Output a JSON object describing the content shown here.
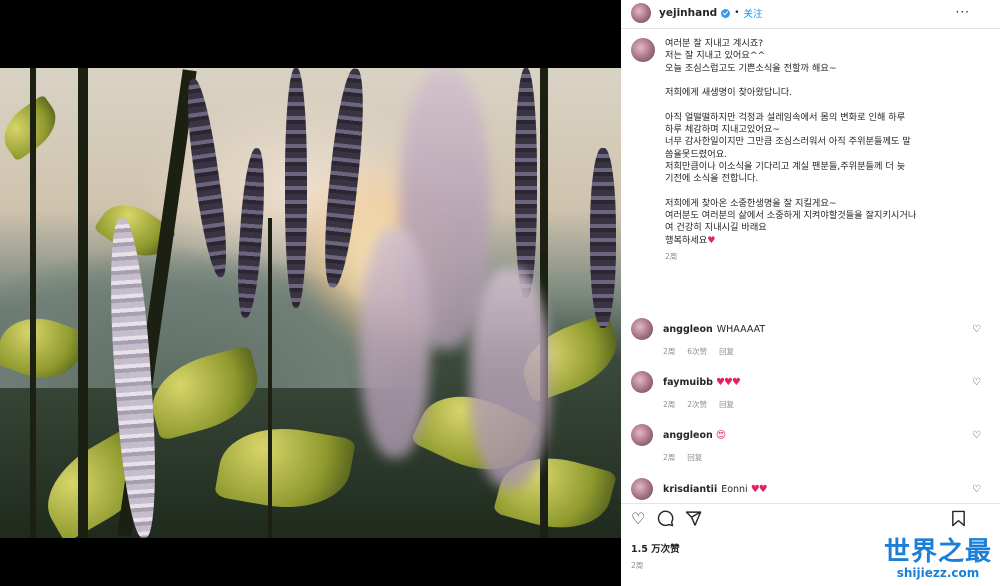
{
  "post": {
    "username": "yejinhand",
    "follow_label": "关注",
    "more_label": "···"
  },
  "caption": {
    "username": "yejinhand",
    "lines": [
      "여러분 잘 지내고 계시죠?",
      "저는 잘 지내고 있어요^^",
      "오늘 조심스럽고도 기쁜소식을 전할까 해요~",
      "",
      "저희에게 새생명이 찾아왔답니다.",
      "",
      "아직 얼떨떨하지만 걱정과 설레임속에서 몸의 변화로 인해 하루",
      "하루 체감하며 지내고있어요~",
      "너무 감사한일이지만 그만큼 조심스러워서 아직 주위분들께도 말",
      "씀을못드렸어요.",
      "저희만큼이나 이소식을 기다리고 계실 팬분들,주위분들께 더 늦",
      "기전에 소식을 전합니다.",
      "",
      "저희에게 찾아온 소중한생명을 잘 지킬게요~",
      "여러분도 여러분의 삶에서 소중하게 지켜야할것들을 잘지키시거나",
      "여 건강히 지내시길 바래요"
    ],
    "sign_off": "행복하세요",
    "time": "2周"
  },
  "comments": [
    {
      "user": "anggleon",
      "text": "WHAAAAT",
      "time": "2周",
      "likes": "6次赞",
      "reply": "回复",
      "hearts": ""
    },
    {
      "user": "faymuibb",
      "text": "",
      "time": "2周",
      "likes": "2次赞",
      "reply": "回复",
      "hearts": "♥♥♥"
    },
    {
      "user": "anggleon",
      "text": "",
      "time": "2周",
      "likes": "",
      "reply": "回复",
      "hearts": "😍"
    },
    {
      "user": "krisdiantii",
      "text": "Eonni",
      "time": "",
      "likes": "",
      "reply": "",
      "hearts": "♥♥"
    }
  ],
  "footer": {
    "likes": "1.5 万次赞",
    "time": "2周"
  },
  "icons": {
    "like": "heart-outline-icon",
    "comment": "comment-icon",
    "share": "paper-plane-icon",
    "save": "bookmark-icon"
  },
  "colors": {
    "link_blue": "#0095f6",
    "verified_blue": "#3797f0",
    "heart_red": "#e0245e",
    "watermark_blue": "#1b7fd8"
  },
  "watermark": {
    "title": "世界之最",
    "domain": "shijiezz.com"
  }
}
